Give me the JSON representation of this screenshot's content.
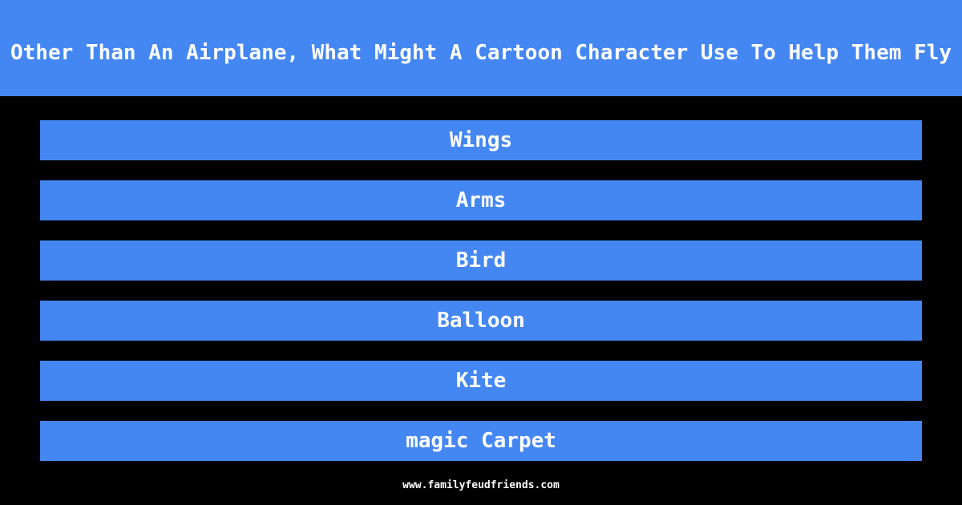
{
  "question": "Other Than An Airplane, What Might A Cartoon Character Use To Help Them Fly",
  "answers": [
    "Wings",
    "Arms",
    "Bird",
    "Balloon",
    "Kite",
    "magic Carpet"
  ],
  "footer": {
    "url": "www.familyfeudfriends.com"
  },
  "colors": {
    "accent": "#4487F2",
    "background": "#000000",
    "text": "#FFFFFF"
  }
}
